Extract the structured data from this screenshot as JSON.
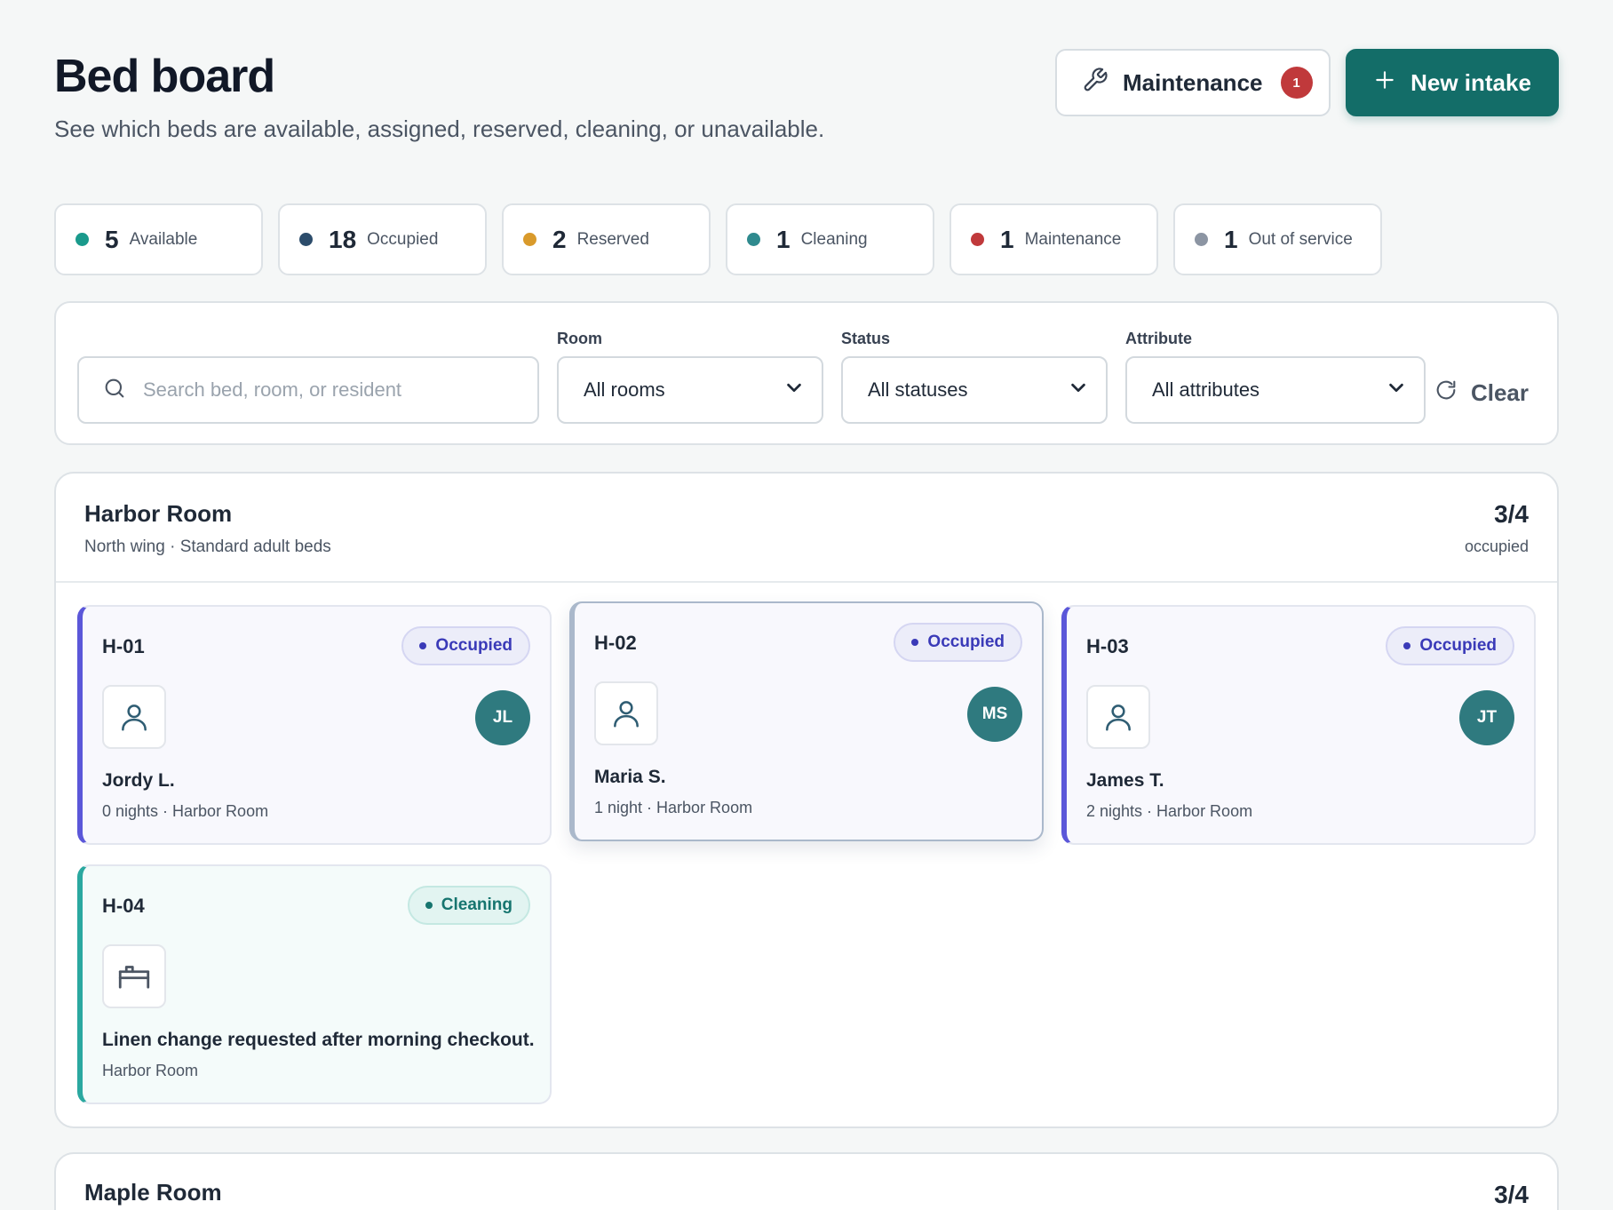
{
  "header": {
    "title": "Bed board",
    "subtitle": "See which beds are available, assigned, reserved, cleaning, or unavailable.",
    "maintenance_label": "Maintenance",
    "maintenance_count": "1",
    "new_intake_label": "New intake"
  },
  "stats": [
    {
      "count": "5",
      "label": "Available",
      "color": "#1a9a8c"
    },
    {
      "count": "18",
      "label": "Occupied",
      "color": "#2c4c6b"
    },
    {
      "count": "2",
      "label": "Reserved",
      "color": "#d99a2b"
    },
    {
      "count": "1",
      "label": "Cleaning",
      "color": "#2f8a8e"
    },
    {
      "count": "1",
      "label": "Maintenance",
      "color": "#c0393b"
    },
    {
      "count": "1",
      "label": "Out of service",
      "color": "#8c95a3"
    }
  ],
  "filters": {
    "search_placeholder": "Search bed, room, or resident",
    "room_label": "Room",
    "room_value": "All rooms",
    "status_label": "Status",
    "status_value": "All statuses",
    "attribute_label": "Attribute",
    "attribute_value": "All attributes",
    "clear_label": "Clear"
  },
  "rooms": [
    {
      "name": "Harbor Room",
      "description": "North wing · Standard adult beds",
      "occupancy": "3/4",
      "occupancy_label": "occupied",
      "beds": [
        {
          "id": "H-01",
          "status": "Occupied",
          "resident": "Jordy L.",
          "initials": "JL",
          "meta": "0 nights · Harbor Room"
        },
        {
          "id": "H-02",
          "status": "Occupied",
          "resident": "Maria S.",
          "initials": "MS",
          "meta": "1 night · Harbor Room"
        },
        {
          "id": "H-03",
          "status": "Occupied",
          "resident": "James T.",
          "initials": "JT",
          "meta": "2 nights · Harbor Room"
        },
        {
          "id": "H-04",
          "status": "Cleaning",
          "note": "Linen change requested after morning checkout.",
          "meta": "Harbor Room"
        }
      ]
    },
    {
      "name": "Maple Room",
      "occupancy": "3/4"
    }
  ],
  "colors": {
    "accent": "#136d68",
    "occupied_bar": "#5b57d9",
    "cleaning_bar": "#2aa8a0",
    "badge": "#c0393b"
  }
}
